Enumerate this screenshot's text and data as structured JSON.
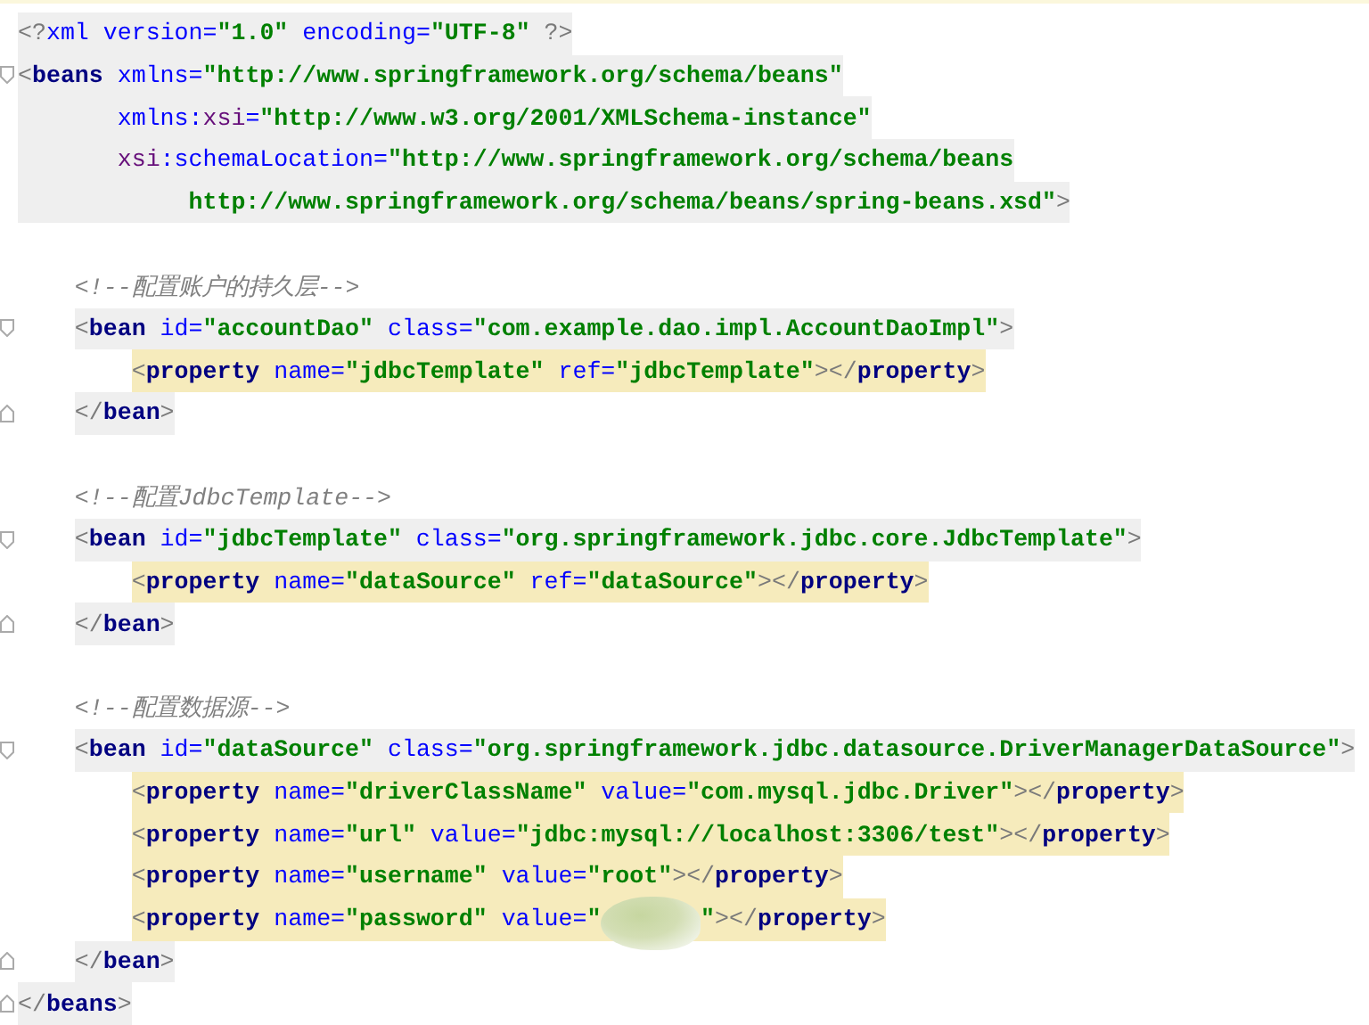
{
  "editor": {
    "lines": [
      {
        "kind": "declaration",
        "tokens": [
          {
            "kind": "bracket",
            "text": "<?"
          },
          {
            "kind": "pi",
            "text": "xml"
          },
          {
            "kind": "attr",
            "text": " version="
          },
          {
            "kind": "value",
            "text": "\"1.0\""
          },
          {
            "kind": "attr",
            "text": " encoding="
          },
          {
            "kind": "value",
            "text": "\"UTF-8\""
          },
          {
            "kind": "bracket",
            "text": " ?>"
          }
        ]
      },
      {
        "kind": "tag",
        "tokens": [
          {
            "kind": "bracket",
            "text": "<"
          },
          {
            "kind": "tag",
            "text": "beans"
          },
          {
            "kind": "attr",
            "text": " xmlns="
          },
          {
            "kind": "value",
            "text": "\"http://www.springframework.org/schema/beans\""
          }
        ],
        "continued": [
          {
            "kind": "tag",
            "tokens": [
              {
                "kind": "attr",
                "text": "       xmlns:"
              },
              {
                "kind": "ns",
                "text": "xsi"
              },
              {
                "kind": "attr",
                "text": "="
              },
              {
                "kind": "value",
                "text": "\"http://www.w3.org/2001/XMLSchema-instance\""
              }
            ]
          },
          {
            "kind": "tag",
            "tokens": [
              {
                "kind": "ns",
                "text": "       xsi"
              },
              {
                "kind": "attr",
                "text": ":schemaLocation="
              },
              {
                "kind": "value",
                "text": "\"http://www.springframework.org/schema/beans"
              }
            ]
          },
          {
            "kind": "tag",
            "tokens": [
              {
                "kind": "value",
                "text": "            http://www.springframework.org/schema/beans/spring-beans.xsd\""
              },
              {
                "kind": "bracket",
                "text": ">"
              }
            ]
          }
        ],
        "children": [
          {
            "kind": "blank"
          },
          {
            "kind": "comment",
            "tokens": [
              {
                "kind": "comment",
                "text": "<!--配置账户的持久层-->"
              }
            ]
          },
          {
            "kind": "tag",
            "tokens": [
              {
                "kind": "bracket",
                "text": "<"
              },
              {
                "kind": "tag",
                "text": "bean"
              },
              {
                "kind": "attr",
                "text": " id="
              },
              {
                "kind": "value",
                "text": "\"accountDao\""
              },
              {
                "kind": "attr",
                "text": " class="
              },
              {
                "kind": "value",
                "text": "\"com.example.dao.impl.AccountDaoImpl\""
              },
              {
                "kind": "bracket",
                "text": ">"
              }
            ],
            "children": [
              {
                "kind": "property",
                "tokens": [
                  {
                    "kind": "bracket",
                    "text": "<"
                  },
                  {
                    "kind": "tag",
                    "text": "property"
                  },
                  {
                    "kind": "attr",
                    "text": " name="
                  },
                  {
                    "kind": "value",
                    "text": "\"jdbcTemplate\""
                  },
                  {
                    "kind": "attr",
                    "text": " ref="
                  },
                  {
                    "kind": "value",
                    "text": "\"jdbcTemplate\""
                  },
                  {
                    "kind": "bracket",
                    "text": "></"
                  },
                  {
                    "kind": "tag",
                    "text": "property"
                  },
                  {
                    "kind": "bracket",
                    "text": ">"
                  }
                ]
              }
            ]
          },
          {
            "kind": "close",
            "tokens": [
              {
                "kind": "bracket",
                "text": "</"
              },
              {
                "kind": "tag",
                "text": "bean"
              },
              {
                "kind": "bracket",
                "text": ">"
              }
            ]
          },
          {
            "kind": "blank"
          },
          {
            "kind": "comment",
            "tokens": [
              {
                "kind": "comment",
                "text": "<!--配置JdbcTemplate-->"
              }
            ]
          },
          {
            "kind": "tag",
            "tokens": [
              {
                "kind": "bracket",
                "text": "<"
              },
              {
                "kind": "tag",
                "text": "bean"
              },
              {
                "kind": "attr",
                "text": " id="
              },
              {
                "kind": "value",
                "text": "\"jdbcTemplate\""
              },
              {
                "kind": "attr",
                "text": " class="
              },
              {
                "kind": "value",
                "text": "\"org.springframework.jdbc.core.JdbcTemplate\""
              },
              {
                "kind": "bracket",
                "text": ">"
              }
            ],
            "children": [
              {
                "kind": "property",
                "tokens": [
                  {
                    "kind": "bracket",
                    "text": "<"
                  },
                  {
                    "kind": "tag",
                    "text": "property"
                  },
                  {
                    "kind": "attr",
                    "text": " name="
                  },
                  {
                    "kind": "value",
                    "text": "\"dataSource\""
                  },
                  {
                    "kind": "attr",
                    "text": " ref="
                  },
                  {
                    "kind": "value",
                    "text": "\"dataSource\""
                  },
                  {
                    "kind": "bracket",
                    "text": "></"
                  },
                  {
                    "kind": "tag",
                    "text": "property"
                  },
                  {
                    "kind": "bracket",
                    "text": ">"
                  }
                ]
              }
            ]
          },
          {
            "kind": "close",
            "tokens": [
              {
                "kind": "bracket",
                "text": "</"
              },
              {
                "kind": "tag",
                "text": "bean"
              },
              {
                "kind": "bracket",
                "text": ">"
              }
            ]
          },
          {
            "kind": "blank"
          },
          {
            "kind": "comment",
            "tokens": [
              {
                "kind": "comment",
                "text": "<!--配置数据源-->"
              }
            ]
          },
          {
            "kind": "tag",
            "tokens": [
              {
                "kind": "bracket",
                "text": "<"
              },
              {
                "kind": "tag",
                "text": "bean"
              },
              {
                "kind": "attr",
                "text": " id="
              },
              {
                "kind": "value",
                "text": "\"dataSource\""
              },
              {
                "kind": "attr",
                "text": " class="
              },
              {
                "kind": "value",
                "text": "\"org.springframework.jdbc.datasource.DriverManagerDataSource\""
              },
              {
                "kind": "bracket",
                "text": ">"
              }
            ],
            "children": [
              {
                "kind": "property",
                "tokens": [
                  {
                    "kind": "bracket",
                    "text": "<"
                  },
                  {
                    "kind": "tag",
                    "text": "property"
                  },
                  {
                    "kind": "attr",
                    "text": " name="
                  },
                  {
                    "kind": "value",
                    "text": "\"driverClassName\""
                  },
                  {
                    "kind": "attr",
                    "text": " value="
                  },
                  {
                    "kind": "value",
                    "text": "\"com.mysql.jdbc.Driver\""
                  },
                  {
                    "kind": "bracket",
                    "text": "></"
                  },
                  {
                    "kind": "tag",
                    "text": "property"
                  },
                  {
                    "kind": "bracket",
                    "text": ">"
                  }
                ]
              },
              {
                "kind": "property",
                "tokens": [
                  {
                    "kind": "bracket",
                    "text": "<"
                  },
                  {
                    "kind": "tag",
                    "text": "property"
                  },
                  {
                    "kind": "attr",
                    "text": " name="
                  },
                  {
                    "kind": "value",
                    "text": "\"url\""
                  },
                  {
                    "kind": "attr",
                    "text": " value="
                  },
                  {
                    "kind": "value",
                    "text": "\"jdbc:mysql://localhost:3306/test\""
                  },
                  {
                    "kind": "bracket",
                    "text": "></"
                  },
                  {
                    "kind": "tag",
                    "text": "property"
                  },
                  {
                    "kind": "bracket",
                    "text": ">"
                  }
                ]
              },
              {
                "kind": "property",
                "tokens": [
                  {
                    "kind": "bracket",
                    "text": "<"
                  },
                  {
                    "kind": "tag",
                    "text": "property"
                  },
                  {
                    "kind": "attr",
                    "text": " name="
                  },
                  {
                    "kind": "value",
                    "text": "\"username\""
                  },
                  {
                    "kind": "attr",
                    "text": " value="
                  },
                  {
                    "kind": "value",
                    "text": "\"root\""
                  },
                  {
                    "kind": "bracket",
                    "text": "></"
                  },
                  {
                    "kind": "tag",
                    "text": "property"
                  },
                  {
                    "kind": "bracket",
                    "text": ">"
                  }
                ]
              },
              {
                "kind": "property",
                "tokens": [
                  {
                    "kind": "bracket",
                    "text": "<"
                  },
                  {
                    "kind": "tag",
                    "text": "property"
                  },
                  {
                    "kind": "attr",
                    "text": " name="
                  },
                  {
                    "kind": "value",
                    "text": "\"password\""
                  },
                  {
                    "kind": "attr",
                    "text": " value="
                  },
                  {
                    "kind": "value",
                    "text": "\""
                  },
                  {
                    "kind": "redacted"
                  },
                  {
                    "kind": "value",
                    "text": "\""
                  },
                  {
                    "kind": "bracket",
                    "text": "></"
                  },
                  {
                    "kind": "tag",
                    "text": "property"
                  },
                  {
                    "kind": "bracket",
                    "text": ">"
                  }
                ]
              }
            ]
          },
          {
            "kind": "close",
            "tokens": [
              {
                "kind": "bracket",
                "text": "</"
              },
              {
                "kind": "tag",
                "text": "bean"
              },
              {
                "kind": "bracket",
                "text": ">"
              }
            ]
          }
        ]
      },
      {
        "kind": "close",
        "tokens": [
          {
            "kind": "bracket",
            "text": "</"
          },
          {
            "kind": "tag",
            "text": "beans"
          },
          {
            "kind": "bracket",
            "text": ">"
          }
        ]
      }
    ]
  }
}
